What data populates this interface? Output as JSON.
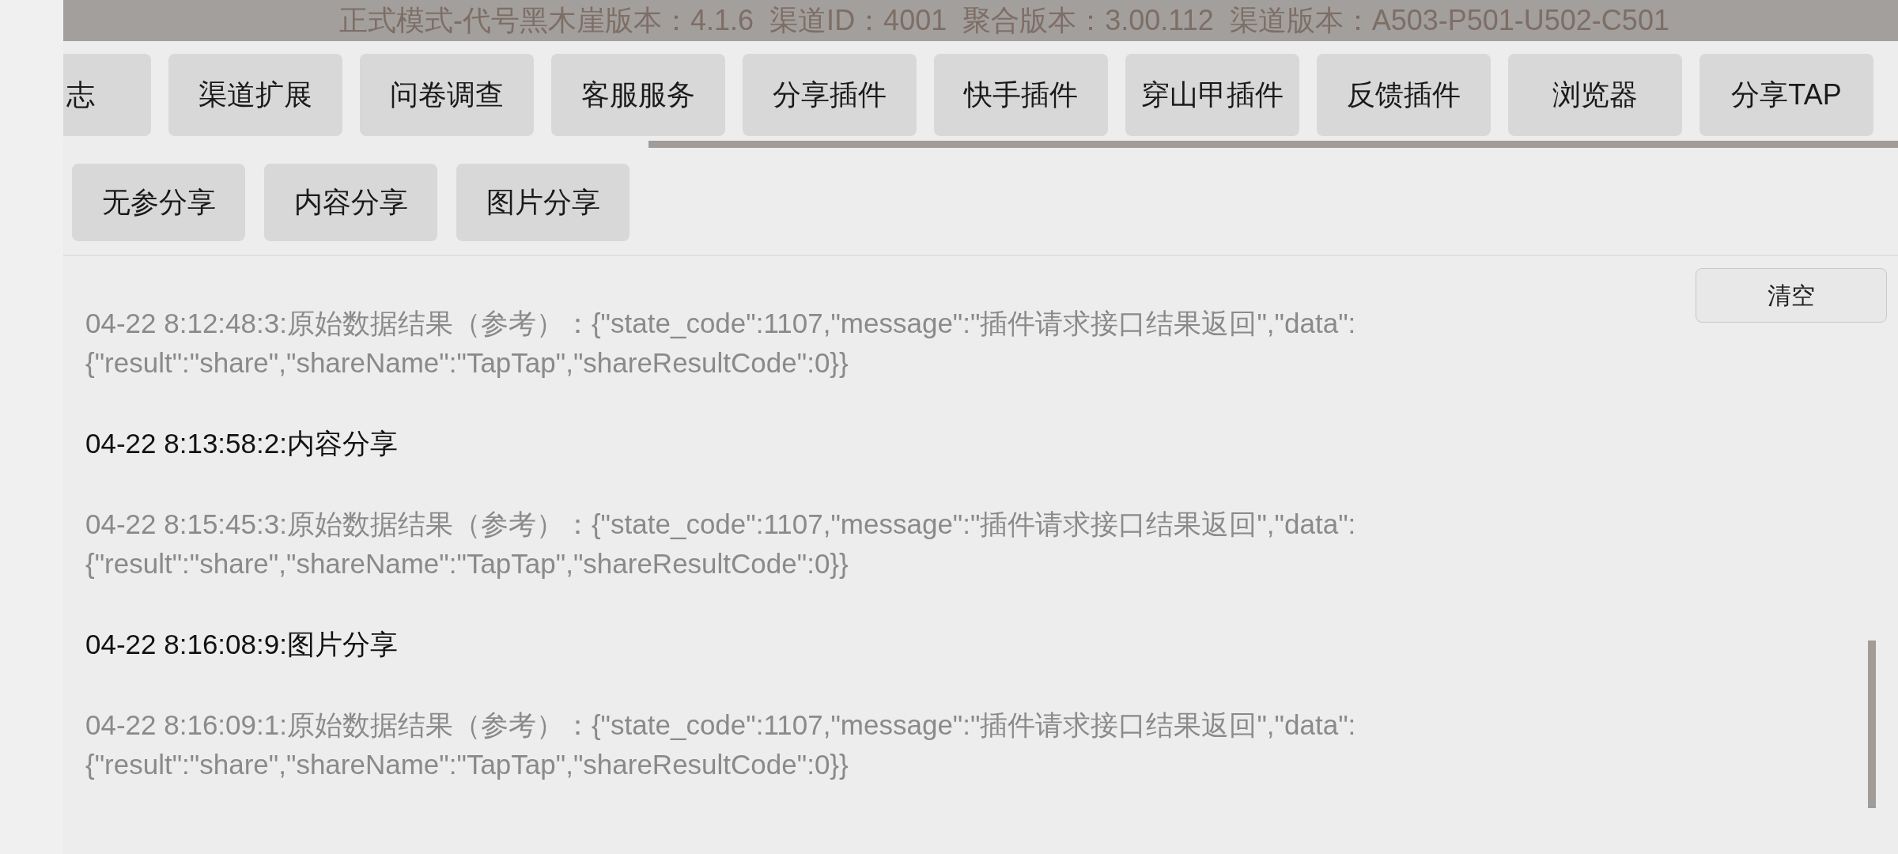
{
  "header": {
    "title": "正式模式-代号黑木崖版本：4.1.6  渠道ID：4001  聚合版本：3.00.112  渠道版本：A503-P501-U502-C501"
  },
  "tab_buttons": [
    "志",
    "渠道扩展",
    "问卷调查",
    "客服服务",
    "分享插件",
    "快手插件",
    "穿山甲插件",
    "反馈插件",
    "浏览器",
    "分享TAP"
  ],
  "action_buttons": [
    "无参分享",
    "内容分享",
    "图片分享"
  ],
  "clear_button": "清空",
  "log": [
    {
      "kind": "result",
      "text": "04-22 8:12:48:3:原始数据结果（参考）：{\"state_code\":1107,\"message\":\"插件请求接口结果返回\",\"data\":{\"result\":\"share\",\"shareName\":\"TapTap\",\"shareResultCode\":0}}"
    },
    {
      "kind": "action",
      "text": "04-22 8:13:58:2:内容分享"
    },
    {
      "kind": "result",
      "text": "04-22 8:15:45:3:原始数据结果（参考）：{\"state_code\":1107,\"message\":\"插件请求接口结果返回\",\"data\":{\"result\":\"share\",\"shareName\":\"TapTap\",\"shareResultCode\":0}}"
    },
    {
      "kind": "action",
      "text": "04-22 8:16:08:9:图片分享"
    },
    {
      "kind": "result",
      "text": "04-22 8:16:09:1:原始数据结果（参考）：{\"state_code\":1107,\"message\":\"插件请求接口结果返回\",\"data\":{\"result\":\"share\",\"shareName\":\"TapTap\",\"shareResultCode\":0}}"
    }
  ]
}
